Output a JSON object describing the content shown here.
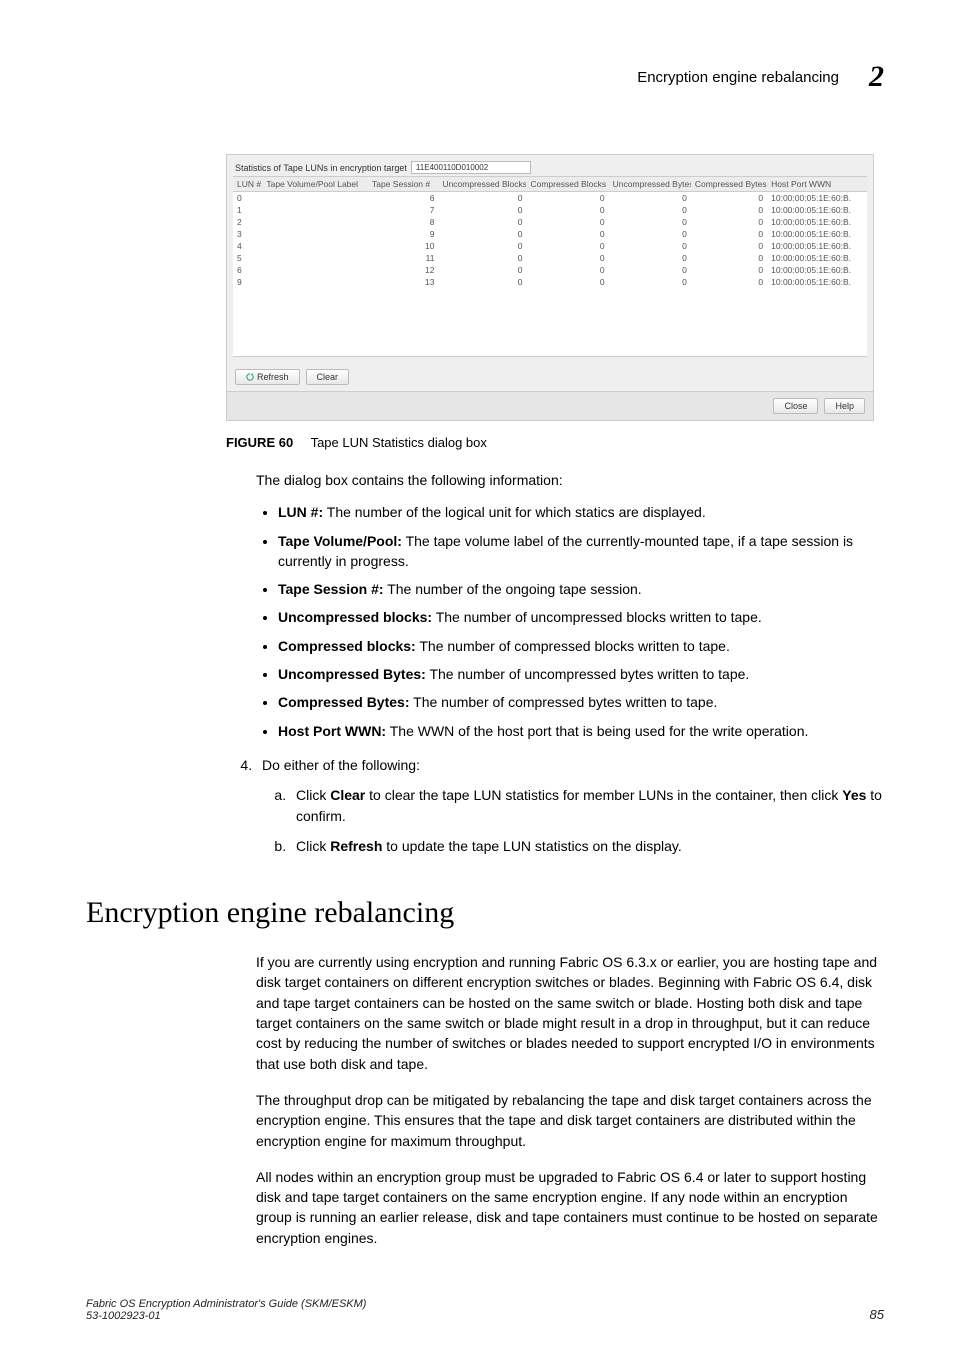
{
  "header": {
    "running_title": "Encryption engine rebalancing",
    "chapter_number": "2"
  },
  "dialog": {
    "stats_label": "Statistics of Tape LUNs in encryption target",
    "target_value": "11E400110D010002",
    "columns": [
      "LUN #",
      "Tape Volume/Pool Label",
      "Tape Session #",
      "Uncompressed Blocks",
      "Compressed Blocks",
      "Uncompressed Bytes",
      "Compressed Bytes",
      "Host Port WWN"
    ],
    "rows": [
      {
        "lun": "0",
        "label": "",
        "sess": "6",
        "ub": "0",
        "cb": "0",
        "uby": "0",
        "cby": "0",
        "wwn": "10:00:00:05:1E:60:B."
      },
      {
        "lun": "1",
        "label": "",
        "sess": "7",
        "ub": "0",
        "cb": "0",
        "uby": "0",
        "cby": "0",
        "wwn": "10:00:00:05:1E:60:B."
      },
      {
        "lun": "2",
        "label": "",
        "sess": "8",
        "ub": "0",
        "cb": "0",
        "uby": "0",
        "cby": "0",
        "wwn": "10:00:00:05:1E:60:B."
      },
      {
        "lun": "3",
        "label": "",
        "sess": "9",
        "ub": "0",
        "cb": "0",
        "uby": "0",
        "cby": "0",
        "wwn": "10:00:00:05:1E:60:B."
      },
      {
        "lun": "4",
        "label": "",
        "sess": "10",
        "ub": "0",
        "cb": "0",
        "uby": "0",
        "cby": "0",
        "wwn": "10:00:00:05:1E:60:B."
      },
      {
        "lun": "5",
        "label": "",
        "sess": "11",
        "ub": "0",
        "cb": "0",
        "uby": "0",
        "cby": "0",
        "wwn": "10:00:00:05:1E:60:B."
      },
      {
        "lun": "6",
        "label": "",
        "sess": "12",
        "ub": "0",
        "cb": "0",
        "uby": "0",
        "cby": "0",
        "wwn": "10:00:00:05:1E:60:B."
      },
      {
        "lun": "9",
        "label": "",
        "sess": "13",
        "ub": "0",
        "cb": "0",
        "uby": "0",
        "cby": "0",
        "wwn": "10:00:00:05:1E:60:B."
      }
    ],
    "refresh_label": "Refresh",
    "clear_label": "Clear",
    "close_label": "Close",
    "help_label": "Help"
  },
  "figure": {
    "label": "FIGURE 60",
    "caption": "Tape LUN Statistics dialog box"
  },
  "intro_line": "The dialog box contains the following information:",
  "definitions": [
    {
      "term": "LUN #:",
      "desc": " The number of the logical unit for which statics are displayed."
    },
    {
      "term": "Tape Volume/Pool:",
      "desc": " The tape volume label of the currently-mounted tape, if a tape session is currently in progress."
    },
    {
      "term": "Tape Session #:",
      "desc": " The number of the ongoing tape session."
    },
    {
      "term": "Uncompressed blocks:",
      "desc": " The number of uncompressed blocks written to tape."
    },
    {
      "term": "Compressed blocks:",
      "desc": " The number of compressed blocks written to tape."
    },
    {
      "term": "Uncompressed Bytes:",
      "desc": " The number of uncompressed bytes written to tape."
    },
    {
      "term": "Compressed Bytes:",
      "desc": " The number of compressed bytes written to tape."
    },
    {
      "term": "Host Port WWN:",
      "desc": " The WWN of the host port that is being used for the write operation."
    }
  ],
  "step4": {
    "lead": "Do either of the following:",
    "a_pre": "Click ",
    "a_bold1": "Clear",
    "a_mid": " to clear the tape LUN statistics for member LUNs in the container, then click ",
    "a_bold2": "Yes",
    "a_post": " to confirm.",
    "b_pre": "Click ",
    "b_bold": "Refresh",
    "b_post": " to update the tape LUN statistics on the display."
  },
  "section": {
    "title": "Encryption engine rebalancing",
    "p1": "If you are currently using encryption and running Fabric OS 6.3.x or earlier, you are hosting tape and disk target containers on different encryption switches or blades. Beginning with Fabric OS 6.4, disk and tape target containers can be hosted on the same switch or blade. Hosting both disk and tape target containers on the same switch or blade might result in a drop in throughput, but it can reduce cost by reducing the number of switches or blades needed to support encrypted I/O in environments that use both disk and tape.",
    "p2": "The throughput drop can be mitigated by rebalancing the tape and disk target containers across the encryption engine. This ensures that the tape and disk target containers are distributed within the encryption engine for maximum throughput.",
    "p3": "All nodes within an encryption group must be upgraded to Fabric OS 6.4 or later to support hosting disk and tape target containers on the same encryption engine. If any node within an encryption group is running an earlier release, disk and tape containers must continue to be hosted on separate encryption engines."
  },
  "footer": {
    "book": "Fabric OS Encryption Administrator's Guide (SKM/ESKM)",
    "docnum": "53-1002923-01",
    "pagenum": "85"
  }
}
